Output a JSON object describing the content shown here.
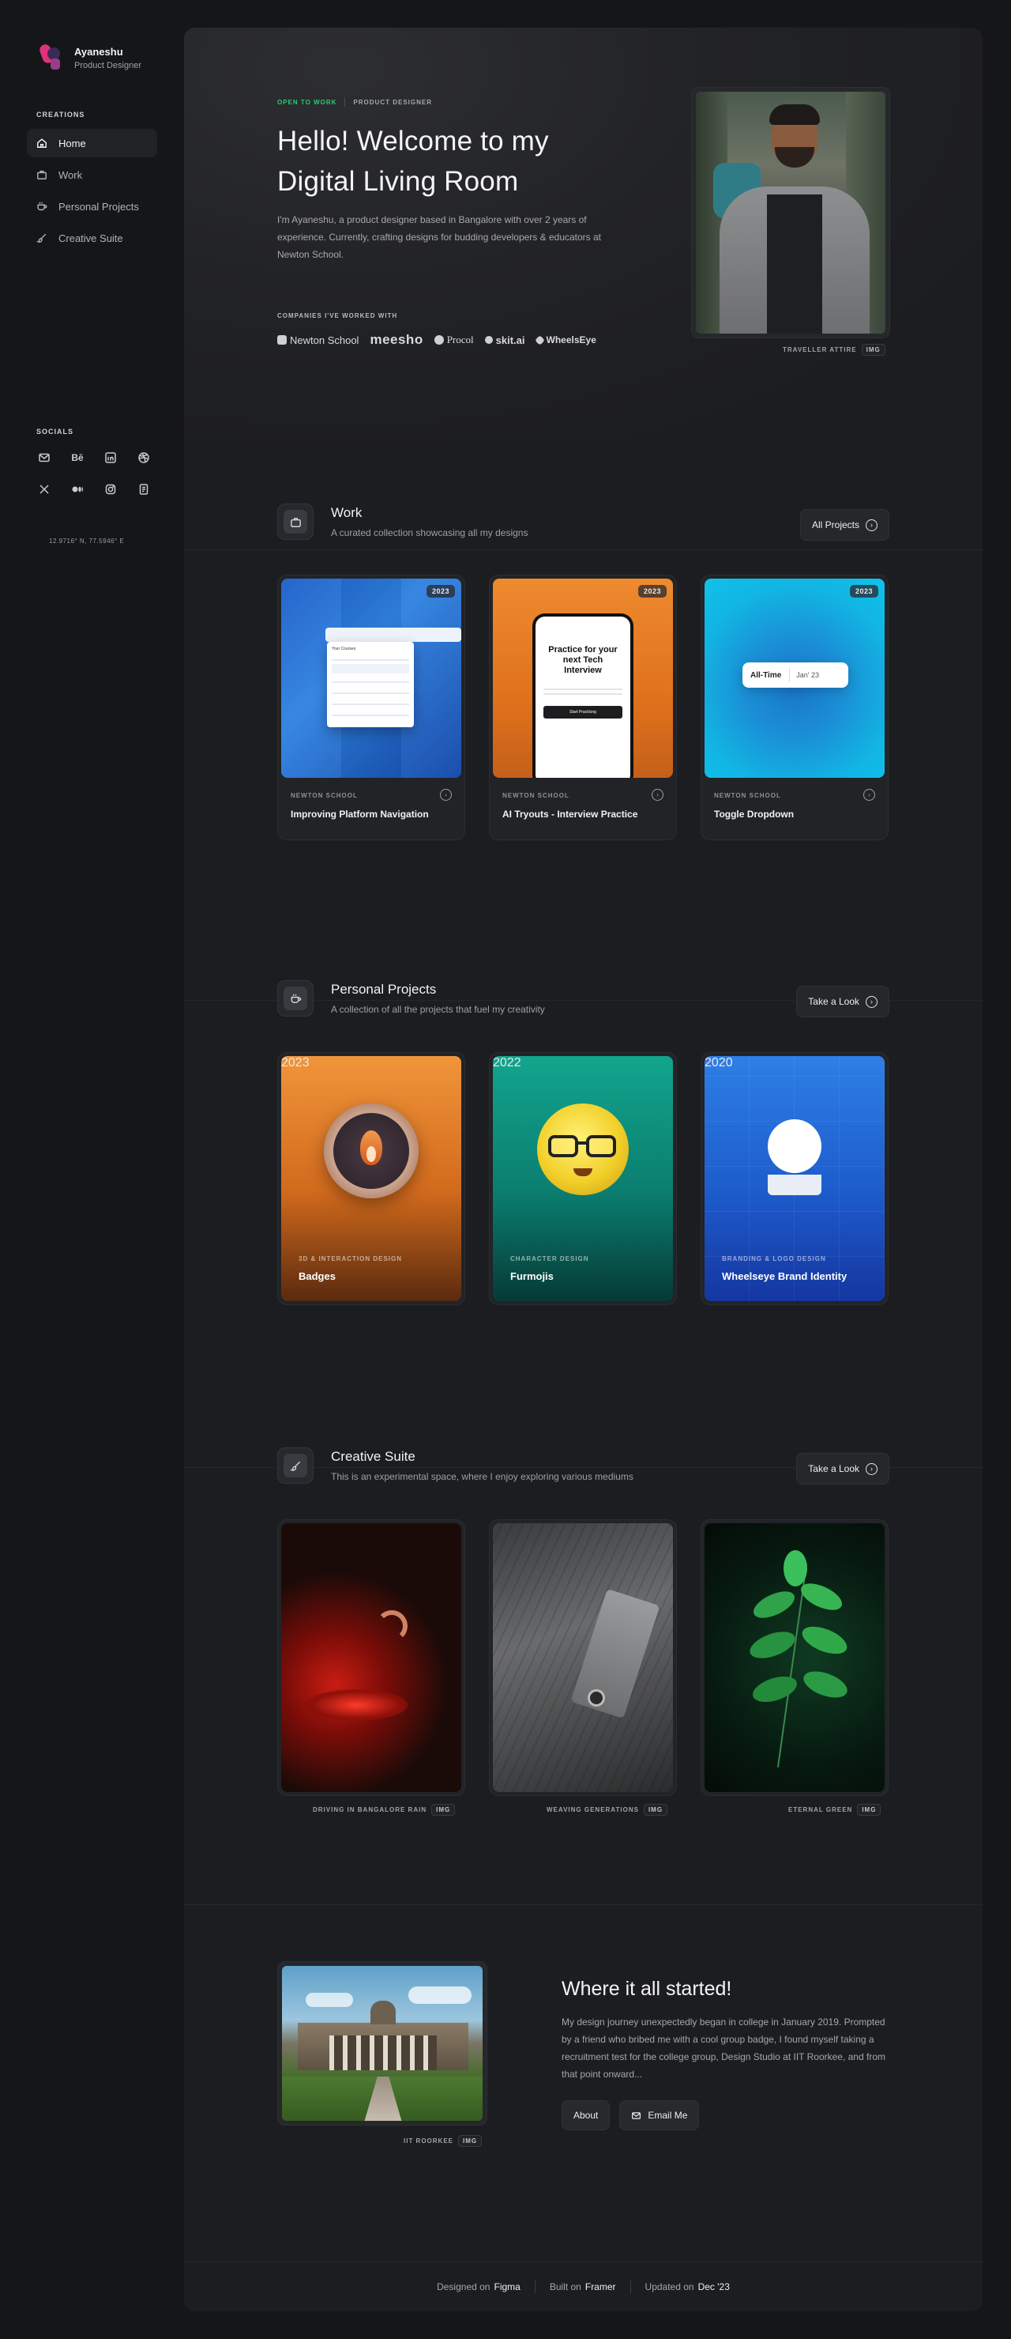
{
  "profile": {
    "name": "Ayaneshu",
    "role": "Product Designer"
  },
  "sidebar": {
    "creations_heading": "CREATIONS",
    "items": [
      {
        "label": "Home",
        "icon": "home-icon",
        "active": true
      },
      {
        "label": "Work",
        "icon": "briefcase-icon",
        "active": false
      },
      {
        "label": "Personal Projects",
        "icon": "coffee-cup-icon",
        "active": false
      },
      {
        "label": "Creative Suite",
        "icon": "brush-icon",
        "active": false
      }
    ],
    "socials_heading": "SOCIALS",
    "behance_label": "Bē",
    "coordinates": "12.9716° N, 77.5946° E"
  },
  "hero": {
    "tag_status": "OPEN TO WORK",
    "tag_role": "PRODUCT DESIGNER",
    "title_line1": "Hello! Welcome to my",
    "title_line2": "Digital Living Room",
    "intro": "I'm Ayaneshu, a product designer based in Bangalore with over 2 years of experience. Currently, crafting designs for budding developers & educators at Newton School.",
    "companies_heading": "COMPANIES I'VE WORKED WITH",
    "companies": [
      "Newton School",
      "meesho",
      "Procol",
      "skit.ai",
      "WheelsEye"
    ],
    "photo_caption": "TRAVELLER ATTIRE",
    "img_badge": "IMG"
  },
  "work": {
    "title": "Work",
    "subtitle": "A curated collection showcasing all my designs",
    "button": "All Projects",
    "cards": [
      {
        "year": "2023",
        "company": "NEWTON SCHOOL",
        "name": "Improving Platform Navigation"
      },
      {
        "year": "2023",
        "company": "NEWTON SCHOOL",
        "name": "AI Tryouts - Interview Practice"
      },
      {
        "year": "2023",
        "company": "NEWTON SCHOOL",
        "name": "Toggle Dropdown"
      }
    ],
    "mock_dropdown_title": "Your Courses",
    "mock_interview_text": "Practice for your next Tech Interview",
    "mock_interview_button": "Start Practicing",
    "mock_toggle_left": "All-Time",
    "mock_toggle_right": "Jan' 23"
  },
  "personal": {
    "title": "Personal Projects",
    "subtitle": "A collection of all the projects that fuel my creativity",
    "button": "Take a Look",
    "cards": [
      {
        "year": "2023",
        "category": "3D & INTERACTION DESIGN",
        "name": "Badges"
      },
      {
        "year": "2022",
        "category": "CHARACTER DESIGN",
        "name": "Furmojis"
      },
      {
        "year": "2020",
        "category": "BRANDING & LOGO DESIGN",
        "name": "Wheelseye Brand Identity"
      }
    ]
  },
  "creative": {
    "title": "Creative Suite",
    "subtitle": "This is an experimental space, where I enjoy exploring various mediums",
    "button": "Take a Look",
    "captions": [
      "DRIVING IN BANGALORE RAIN",
      "WEAVING GENERATIONS",
      "ETERNAL GREEN"
    ]
  },
  "story": {
    "caption": "IIT ROORKEE",
    "title": "Where it all started!",
    "text": "My design journey unexpectedly began in college in January 2019. Prompted by a friend who bribed me with a cool group badge, I found myself taking a recruitment test for the college group, Design Studio at IIT Roorkee, and from that point onward...",
    "about_button": "About",
    "email_button": "Email Me"
  },
  "footer": {
    "designed_label": "Designed on",
    "designed_value": "Figma",
    "built_label": "Built on",
    "built_value": "Framer",
    "updated_label": "Updated on",
    "updated_value": "Dec '23"
  }
}
